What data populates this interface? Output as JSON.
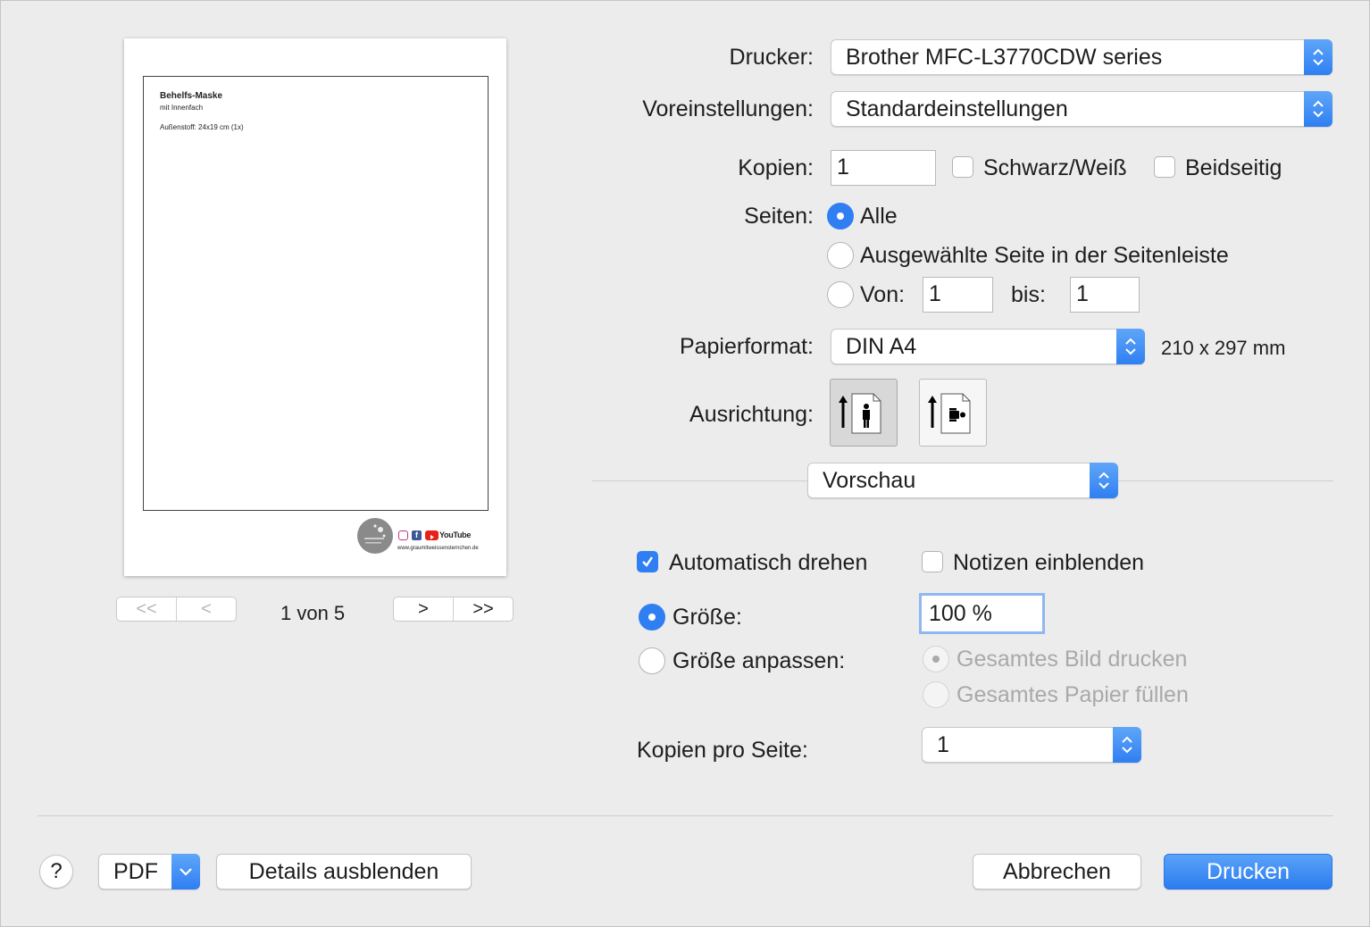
{
  "printer": {
    "label": "Drucker:",
    "value": "Brother MFC-L3770CDW series"
  },
  "presets": {
    "label": "Voreinstellungen:",
    "value": "Standardeinstellungen"
  },
  "copies": {
    "label": "Kopien:",
    "value": "1",
    "bw_label": "Schwarz/Weiß",
    "duplex_label": "Beidseitig"
  },
  "pages": {
    "label": "Seiten:",
    "all_label": "Alle",
    "selected_label": "Ausgewählte Seite in der Seitenleiste",
    "from_label": "Von:",
    "from_value": "1",
    "to_label": "bis:",
    "to_value": "1"
  },
  "paper": {
    "label": "Papierformat:",
    "value": "DIN A4",
    "dimensions": "210 x 297 mm"
  },
  "orientation": {
    "label": "Ausrichtung:",
    "selected": "portrait"
  },
  "section_popup": {
    "value": "Vorschau"
  },
  "preview_options": {
    "auto_rotate_label": "Automatisch drehen",
    "show_notes_label": "Notizen einblenden",
    "size_label": "Größe:",
    "size_value": "100 %",
    "fit_label": "Größe anpassen:",
    "print_entire_label": "Gesamtes Bild drucken",
    "fill_paper_label": "Gesamtes Papier füllen",
    "per_page_label": "Kopien pro Seite:",
    "per_page_value": "1"
  },
  "preview_page": {
    "title": "Behelfs-Maske",
    "subtitle": "mit Innenfach",
    "line": "Außenstoff: 24x19 cm (1x)",
    "footer_social": "YouTube",
    "footer_url": "www.graumitweissensternchen.de"
  },
  "pagination": {
    "indicator": "1 von 5",
    "first": "<<",
    "prev": "<",
    "next": ">",
    "last": ">>"
  },
  "footer": {
    "help": "?",
    "pdf": "PDF",
    "details": "Details ausblenden",
    "cancel": "Abbrechen",
    "print": "Drucken"
  },
  "colors": {
    "accent": "#2f7ff2",
    "background": "#ececec"
  }
}
